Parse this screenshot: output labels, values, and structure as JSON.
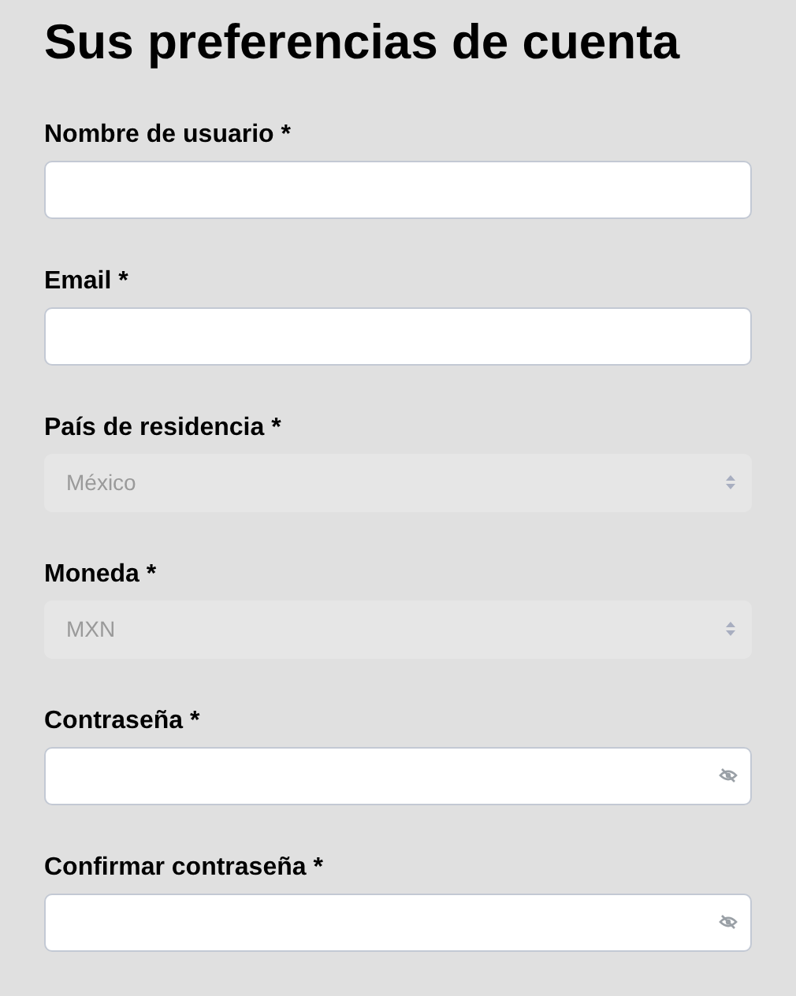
{
  "title": "Sus preferencias de cuenta",
  "fields": [
    {
      "kind": "text",
      "label": "Nombre de usuario *"
    },
    {
      "kind": "text",
      "label": "Email *"
    },
    {
      "kind": "select",
      "label": "País de residencia *",
      "value": "México",
      "disabled": true
    },
    {
      "kind": "select",
      "label": "Moneda *",
      "value": "MXN",
      "disabled": true
    },
    {
      "kind": "password",
      "label": "Contraseña *"
    },
    {
      "kind": "password",
      "label": "Confirmar contraseña *"
    }
  ]
}
